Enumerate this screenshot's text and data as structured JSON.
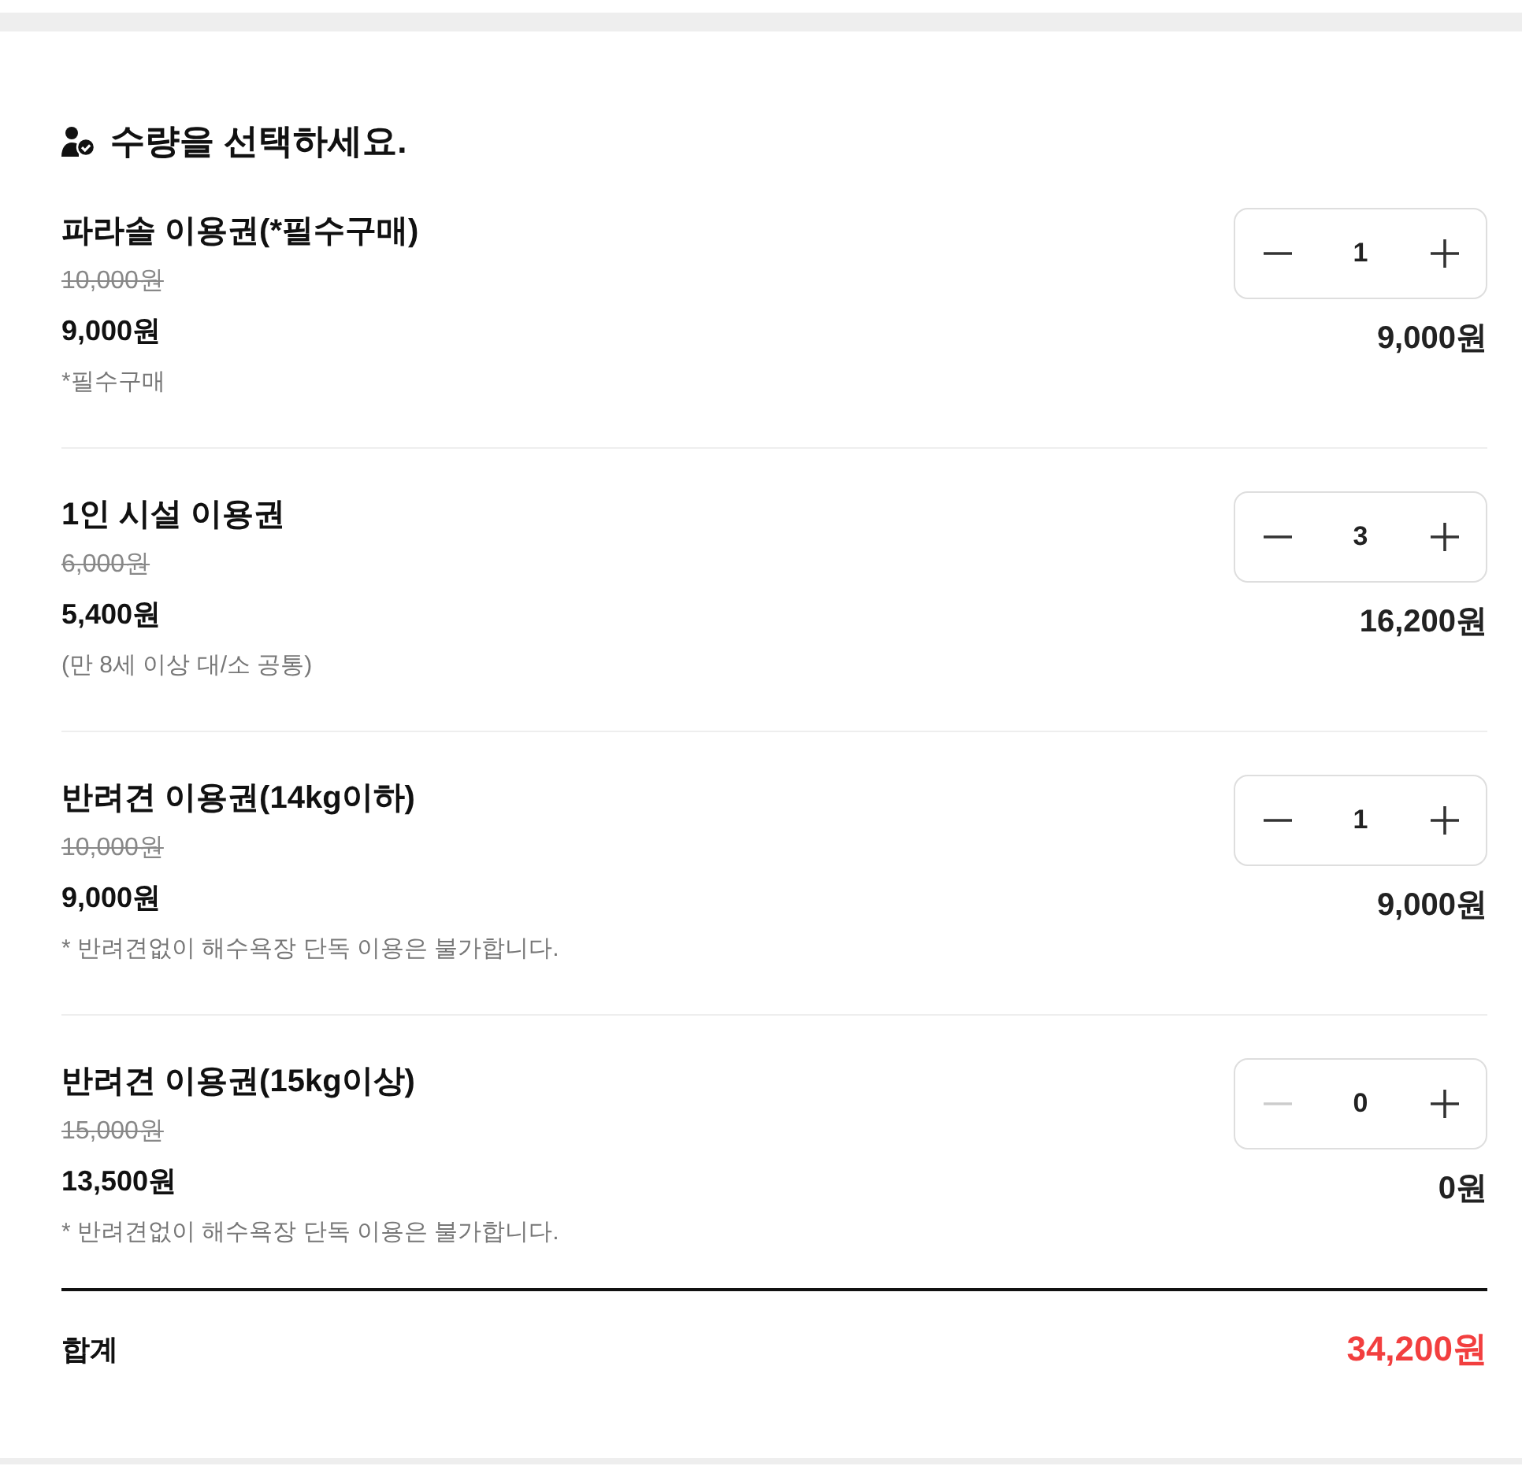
{
  "heading": {
    "text": "수량을 선택하세요."
  },
  "items": [
    {
      "name": "파라솔 이용권(*필수구매)",
      "original_price": "10,000원",
      "price": "9,000원",
      "note": "*필수구매",
      "quantity": "1",
      "decrease_disabled": false,
      "subtotal": "9,000원"
    },
    {
      "name": "1인 시설 이용권",
      "original_price": "6,000원",
      "price": "5,400원",
      "note": "(만 8세 이상 대/소 공통)",
      "quantity": "3",
      "decrease_disabled": false,
      "subtotal": "16,200원"
    },
    {
      "name": "반려견 이용권(14kg이하)",
      "original_price": "10,000원",
      "price": "9,000원",
      "note": "* 반려견없이 해수욕장 단독 이용은 불가합니다.",
      "quantity": "1",
      "decrease_disabled": false,
      "subtotal": "9,000원"
    },
    {
      "name": "반려견 이용권(15kg이상)",
      "original_price": "15,000원",
      "price": "13,500원",
      "note": "* 반려견없이 해수욕장 단독 이용은 불가합니다.",
      "quantity": "0",
      "decrease_disabled": true,
      "subtotal": "0원"
    }
  ],
  "total": {
    "label": "합계",
    "amount": "34,200원"
  }
}
